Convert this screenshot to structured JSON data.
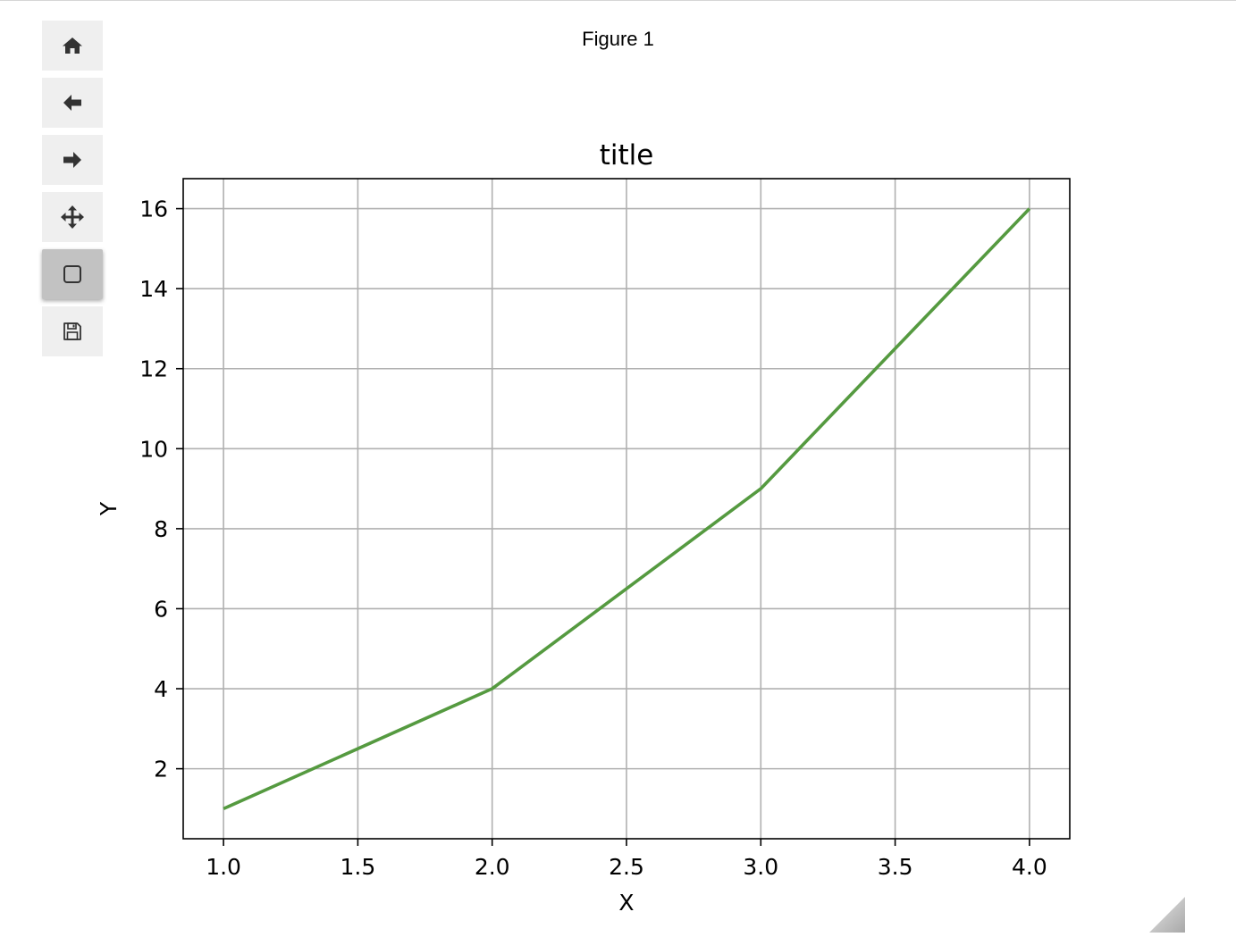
{
  "window": {
    "figure_title": "Figure 1"
  },
  "toolbar": {
    "buttons": [
      {
        "name": "home",
        "icon": "home-icon",
        "active": false
      },
      {
        "name": "back",
        "icon": "arrow-left-icon",
        "active": false
      },
      {
        "name": "forward",
        "icon": "arrow-right-icon",
        "active": false
      },
      {
        "name": "pan",
        "icon": "move-icon",
        "active": false
      },
      {
        "name": "zoom",
        "icon": "zoom-rect-icon",
        "active": true
      },
      {
        "name": "save",
        "icon": "save-icon",
        "active": false
      }
    ]
  },
  "colors": {
    "line": "#559a40",
    "grid": "#b0b0b0",
    "axis": "#000000",
    "toolbar_button": "#efefef",
    "toolbar_button_active": "#c2c2c2"
  },
  "chart_data": {
    "type": "line",
    "title": "title",
    "xlabel": "X",
    "ylabel": "Y",
    "xlim": [
      0.85,
      4.15
    ],
    "ylim": [
      0.25,
      16.75
    ],
    "xticks": [
      1.0,
      1.5,
      2.0,
      2.5,
      3.0,
      3.5,
      4.0
    ],
    "xtick_labels": [
      "1.0",
      "1.5",
      "2.0",
      "2.5",
      "3.0",
      "3.5",
      "4.0"
    ],
    "yticks": [
      2,
      4,
      6,
      8,
      10,
      12,
      14,
      16
    ],
    "ytick_labels": [
      "2",
      "4",
      "6",
      "8",
      "10",
      "12",
      "14",
      "16"
    ],
    "grid": true,
    "series": [
      {
        "x": [
          1.0,
          1.5,
          2.0,
          2.5,
          3.0,
          3.5,
          4.0
        ],
        "y": [
          1,
          2.5,
          4,
          6.5,
          9,
          12.5,
          16
        ]
      }
    ]
  }
}
